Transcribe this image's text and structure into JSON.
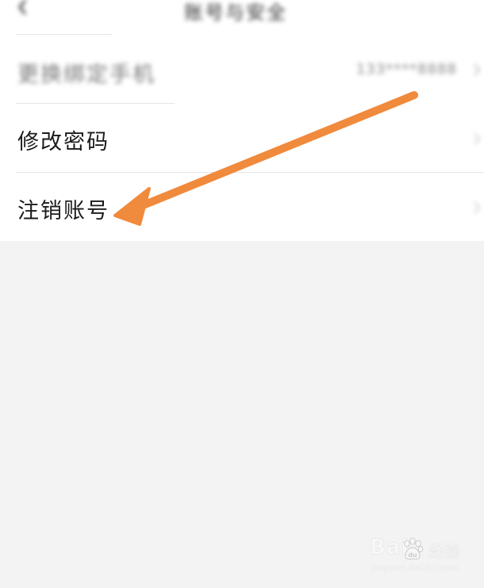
{
  "header": {
    "title": "账号与安全",
    "back_icon": "chevron-left-icon"
  },
  "settings": {
    "rows": [
      {
        "label": "更换绑定手机",
        "value": "133****8888"
      },
      {
        "label": "修改密码"
      },
      {
        "label": "注销账号"
      }
    ],
    "chevron_icon": "chevron-right-icon"
  },
  "annotation": {
    "arrow_color": "#f08a3c",
    "arrow_target": "注销账号"
  },
  "watermark": {
    "brand": "Bai",
    "brand_suffix": "经验",
    "url": "jingyan.baidu.com"
  }
}
